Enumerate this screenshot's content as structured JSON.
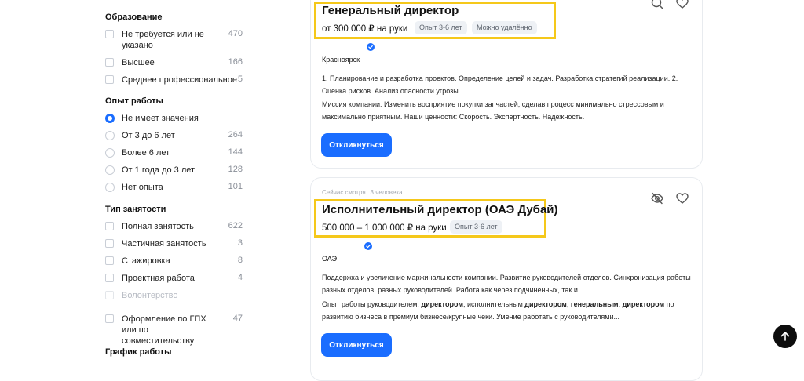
{
  "sidebar": {
    "education": {
      "title": "Образование",
      "options": [
        {
          "label": "Не требуется или не указано",
          "count": "470"
        },
        {
          "label": "Высшее",
          "count": "166"
        },
        {
          "label": "Среднее профессиональное",
          "count": "5"
        }
      ]
    },
    "experience": {
      "title": "Опыт работы",
      "options": [
        {
          "label": "Не имеет значения",
          "count": "",
          "selected": true
        },
        {
          "label": "От 3 до 6 лет",
          "count": "264"
        },
        {
          "label": "Более 6 лет",
          "count": "144"
        },
        {
          "label": "От 1 года до 3 лет",
          "count": "128"
        },
        {
          "label": "Нет опыта",
          "count": "101"
        }
      ]
    },
    "employment": {
      "title": "Тип занятости",
      "options": [
        {
          "label": "Полная занятость",
          "count": "622"
        },
        {
          "label": "Частичная занятость",
          "count": "3"
        },
        {
          "label": "Стажировка",
          "count": "8"
        },
        {
          "label": "Проектная работа",
          "count": "4"
        },
        {
          "label": "Волонтерство",
          "count": "",
          "disabled": true
        },
        {
          "label": "Оформление по ГПХ или по совместительству",
          "count": "47"
        }
      ]
    },
    "schedule": {
      "title": "График работы"
    }
  },
  "vacancies": [
    {
      "title": "Генеральный директор",
      "salary": "от 300 000 ₽ на руки",
      "tags": [
        "Опыт 3-6 лет",
        "Можно удалённо"
      ],
      "city": "Красноярск",
      "desc1": "1. Планирование и разработка проектов. Определение целей и задач. Разработка стратегий реализации. 2. Оценка рисков. Анализ опасности угрозы.",
      "desc2": "Миссия компании: Изменить восприятие покупки запчастей, сделав процесс минимально стрессовым и максимально приятным. Наши ценности: Скорость. Экспертность. Надежность.",
      "button": "Откликнуться"
    },
    {
      "watching": "Сейчас смотрят 3 человека",
      "title": "Исполнительный директор (ОАЭ Дубай)",
      "salary": "500 000 – 1 000 000 ₽ на руки",
      "tags": [
        "Опыт 3-6 лет"
      ],
      "city": "ОАЭ",
      "desc1": "Поддержка и увеличение маржинальности компании. Развитие руководителей отделов. Синхронизация работы разных отделов, разных руководителей. Работа как через подчиненных, так и...",
      "desc2_parts": [
        "Опыт работы руководителем, ",
        "директором",
        ", исполнительным ",
        "директором",
        ", ",
        "генеральным",
        ", ",
        "директором",
        " по развитию бизнеса в премиум бизнесе/крупные чеки. Умение работать с руководителями..."
      ],
      "button": "Откликнуться"
    }
  ],
  "colors": {
    "accent": "#1a6dff",
    "highlight": "#f5c81a"
  },
  "icons": [
    "search-icon",
    "heart-icon",
    "eye-off-icon",
    "verified-icon",
    "arrow-up-icon"
  ]
}
